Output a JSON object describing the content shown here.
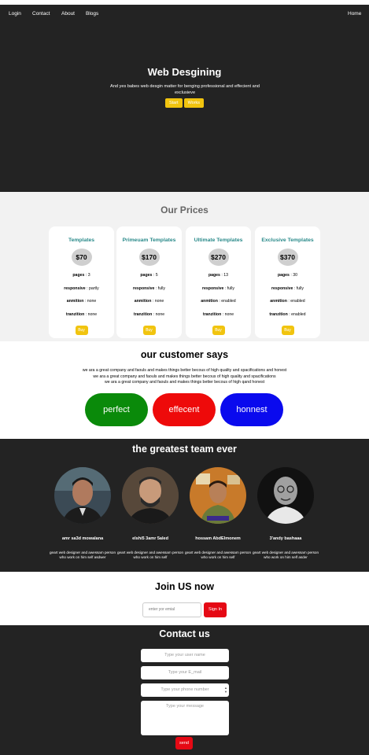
{
  "nav": {
    "login": "Login",
    "contact": "Contact",
    "about": "About",
    "blogs": "Blogs",
    "home": "Home"
  },
  "hero": {
    "title": "Web Desgining",
    "subtitle": "And yes babes web desgin matter for benging professional and effecient and exclusieve",
    "start_label": "Start",
    "works_label": "Works"
  },
  "prices": {
    "title": "Our Prices",
    "cards": [
      {
        "title": "Templates",
        "price": "$70",
        "pages": "3",
        "responsive": "partly",
        "anmition": "none",
        "tranzition": "none",
        "buy": "Buy"
      },
      {
        "title": "Primeuam Templates",
        "price": "$170",
        "pages": "5",
        "responsive": "fully",
        "anmition": "none",
        "tranzition": "none",
        "buy": "Buy"
      },
      {
        "title": "Ultimate Templates",
        "price": "$270",
        "pages": "13",
        "responsive": "fully",
        "anmition": "enabled",
        "tranzition": "none",
        "buy": "Buy"
      },
      {
        "title": "Exclusive Templates",
        "price": "$370",
        "pages": "30",
        "responsive": "fully",
        "anmition": "enabled",
        "tranzition": "enabled",
        "buy": "Buy"
      }
    ],
    "labels": {
      "pages": "pages",
      "responsive": "responsive",
      "anmition": "anmition",
      "tranzition": "tranzition"
    }
  },
  "customer": {
    "title": "our customer says",
    "lines": [
      "we ara a great company and faouls and makes things better becous of high quality and spacifications and honest",
      "we ara a great company and faouls and makes things better becous of high quality and spacifications",
      "we ara a great company and faouls and makes things better becous of high qand honest"
    ],
    "pills": [
      {
        "label": "perfect",
        "color": "#0a8a0a"
      },
      {
        "label": "effecent",
        "color": "#ee0a0a"
      },
      {
        "label": "honnest",
        "color": "#0a0aee"
      }
    ]
  },
  "team": {
    "title": "the greatest team ever",
    "members": [
      {
        "name": "amr sa3d mowalana",
        "desc": "geart web designer and awessam person who work on him self asdwer",
        "icon": "person-photo"
      },
      {
        "name": "elshi5 3amr 5aled",
        "desc": "geart web designer and awessam person who work on him self",
        "icon": "person-photo"
      },
      {
        "name": "hossam AbdElmonem",
        "desc": "geart web designer and awessam person who work on him self",
        "icon": "person-photo"
      },
      {
        "name": "3'andy bashaaa",
        "desc": "geart web designer and awessam person who work on him self asder",
        "icon": "person-photo"
      }
    ]
  },
  "join": {
    "title": "Join US now",
    "email_placeholder": "enter yor emial",
    "button": "Sign In"
  },
  "contact": {
    "title": "Contact us",
    "name_placeholder": "Type your user name",
    "email_placeholder": "Type your E_mail",
    "phone_placeholder": "Type your phone number",
    "message_placeholder": "Type your message",
    "send": "send"
  }
}
